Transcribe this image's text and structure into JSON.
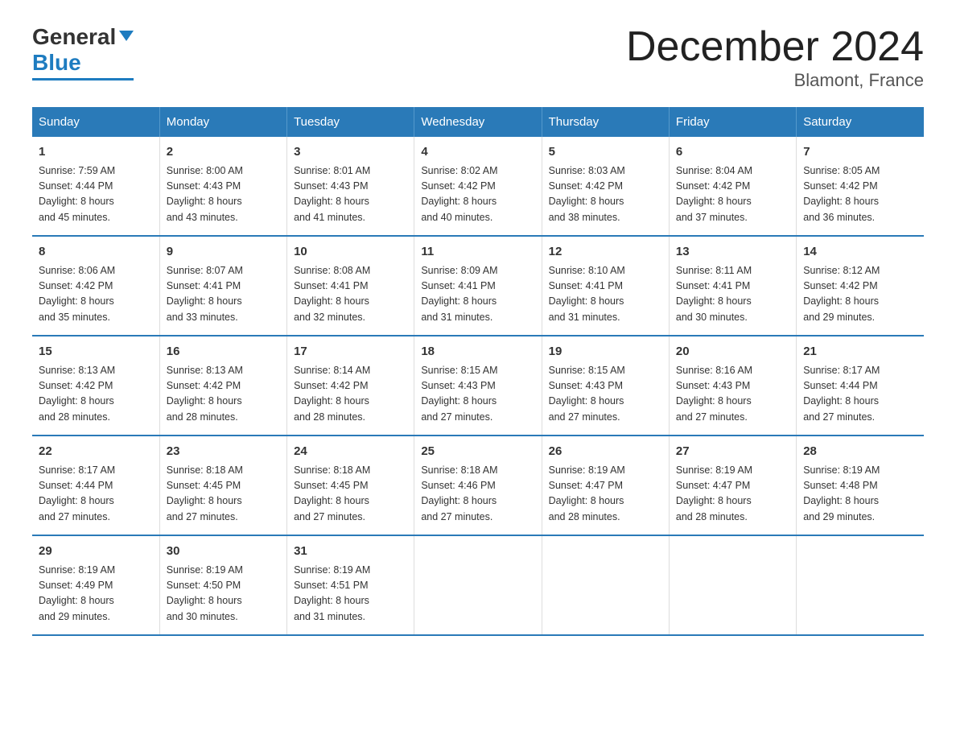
{
  "header": {
    "title": "December 2024",
    "subtitle": "Blamont, France",
    "logo_general": "General",
    "logo_blue": "Blue"
  },
  "calendar": {
    "weekdays": [
      "Sunday",
      "Monday",
      "Tuesday",
      "Wednesday",
      "Thursday",
      "Friday",
      "Saturday"
    ],
    "weeks": [
      [
        {
          "day": "1",
          "sunrise": "7:59 AM",
          "sunset": "4:44 PM",
          "daylight": "8 hours and 45 minutes."
        },
        {
          "day": "2",
          "sunrise": "8:00 AM",
          "sunset": "4:43 PM",
          "daylight": "8 hours and 43 minutes."
        },
        {
          "day": "3",
          "sunrise": "8:01 AM",
          "sunset": "4:43 PM",
          "daylight": "8 hours and 41 minutes."
        },
        {
          "day": "4",
          "sunrise": "8:02 AM",
          "sunset": "4:42 PM",
          "daylight": "8 hours and 40 minutes."
        },
        {
          "day": "5",
          "sunrise": "8:03 AM",
          "sunset": "4:42 PM",
          "daylight": "8 hours and 38 minutes."
        },
        {
          "day": "6",
          "sunrise": "8:04 AM",
          "sunset": "4:42 PM",
          "daylight": "8 hours and 37 minutes."
        },
        {
          "day": "7",
          "sunrise": "8:05 AM",
          "sunset": "4:42 PM",
          "daylight": "8 hours and 36 minutes."
        }
      ],
      [
        {
          "day": "8",
          "sunrise": "8:06 AM",
          "sunset": "4:42 PM",
          "daylight": "8 hours and 35 minutes."
        },
        {
          "day": "9",
          "sunrise": "8:07 AM",
          "sunset": "4:41 PM",
          "daylight": "8 hours and 33 minutes."
        },
        {
          "day": "10",
          "sunrise": "8:08 AM",
          "sunset": "4:41 PM",
          "daylight": "8 hours and 32 minutes."
        },
        {
          "day": "11",
          "sunrise": "8:09 AM",
          "sunset": "4:41 PM",
          "daylight": "8 hours and 31 minutes."
        },
        {
          "day": "12",
          "sunrise": "8:10 AM",
          "sunset": "4:41 PM",
          "daylight": "8 hours and 31 minutes."
        },
        {
          "day": "13",
          "sunrise": "8:11 AM",
          "sunset": "4:41 PM",
          "daylight": "8 hours and 30 minutes."
        },
        {
          "day": "14",
          "sunrise": "8:12 AM",
          "sunset": "4:42 PM",
          "daylight": "8 hours and 29 minutes."
        }
      ],
      [
        {
          "day": "15",
          "sunrise": "8:13 AM",
          "sunset": "4:42 PM",
          "daylight": "8 hours and 28 minutes."
        },
        {
          "day": "16",
          "sunrise": "8:13 AM",
          "sunset": "4:42 PM",
          "daylight": "8 hours and 28 minutes."
        },
        {
          "day": "17",
          "sunrise": "8:14 AM",
          "sunset": "4:42 PM",
          "daylight": "8 hours and 28 minutes."
        },
        {
          "day": "18",
          "sunrise": "8:15 AM",
          "sunset": "4:43 PM",
          "daylight": "8 hours and 27 minutes."
        },
        {
          "day": "19",
          "sunrise": "8:15 AM",
          "sunset": "4:43 PM",
          "daylight": "8 hours and 27 minutes."
        },
        {
          "day": "20",
          "sunrise": "8:16 AM",
          "sunset": "4:43 PM",
          "daylight": "8 hours and 27 minutes."
        },
        {
          "day": "21",
          "sunrise": "8:17 AM",
          "sunset": "4:44 PM",
          "daylight": "8 hours and 27 minutes."
        }
      ],
      [
        {
          "day": "22",
          "sunrise": "8:17 AM",
          "sunset": "4:44 PM",
          "daylight": "8 hours and 27 minutes."
        },
        {
          "day": "23",
          "sunrise": "8:18 AM",
          "sunset": "4:45 PM",
          "daylight": "8 hours and 27 minutes."
        },
        {
          "day": "24",
          "sunrise": "8:18 AM",
          "sunset": "4:45 PM",
          "daylight": "8 hours and 27 minutes."
        },
        {
          "day": "25",
          "sunrise": "8:18 AM",
          "sunset": "4:46 PM",
          "daylight": "8 hours and 27 minutes."
        },
        {
          "day": "26",
          "sunrise": "8:19 AM",
          "sunset": "4:47 PM",
          "daylight": "8 hours and 28 minutes."
        },
        {
          "day": "27",
          "sunrise": "8:19 AM",
          "sunset": "4:47 PM",
          "daylight": "8 hours and 28 minutes."
        },
        {
          "day": "28",
          "sunrise": "8:19 AM",
          "sunset": "4:48 PM",
          "daylight": "8 hours and 29 minutes."
        }
      ],
      [
        {
          "day": "29",
          "sunrise": "8:19 AM",
          "sunset": "4:49 PM",
          "daylight": "8 hours and 29 minutes."
        },
        {
          "day": "30",
          "sunrise": "8:19 AM",
          "sunset": "4:50 PM",
          "daylight": "8 hours and 30 minutes."
        },
        {
          "day": "31",
          "sunrise": "8:19 AM",
          "sunset": "4:51 PM",
          "daylight": "8 hours and 31 minutes."
        },
        null,
        null,
        null,
        null
      ]
    ],
    "sunrise_label": "Sunrise: ",
    "sunset_label": "Sunset: ",
    "daylight_label": "Daylight: "
  }
}
